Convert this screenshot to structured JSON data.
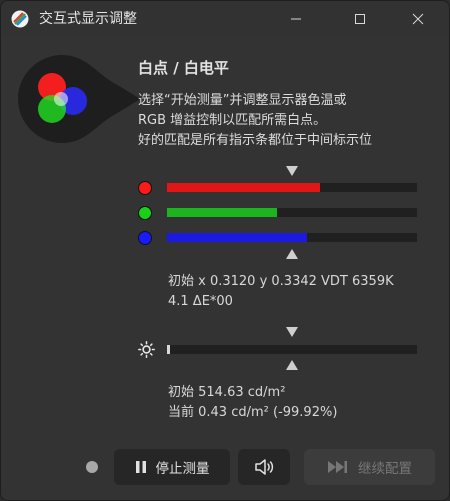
{
  "window": {
    "title": "交互式显示调整",
    "controls": {
      "minimize": "minimize-icon",
      "maximize": "maximize-icon",
      "close": "close-icon"
    }
  },
  "header": {
    "heading": "白点 / 白电平",
    "instructions": [
      "选择“开始测量”并调整显示器色温或",
      "RGB 增益控制以匹配所需白点。",
      "好的匹配是所有指示条都位于中间标示位"
    ]
  },
  "rgb_bars": [
    {
      "name": "red",
      "color": "#ff1a1a",
      "fill_color": "#e21616",
      "level": 0.61
    },
    {
      "name": "green",
      "color": "#1ad11a",
      "fill_color": "#1db51d",
      "level": 0.44
    },
    {
      "name": "blue",
      "color": "#1a1aff",
      "fill_color": "#1a1ae0",
      "level": 0.56
    }
  ],
  "whitepoint_info": {
    "line1": "初始 x 0.3120 y 0.3342 VDT 6359K",
    "line2": "4.1 ΔE*00"
  },
  "luminance": {
    "icon": "brightness-icon",
    "level": 0.01,
    "line1": "初始 514.63 cd/m²",
    "line2": "当前 0.43 cd/m² (-99.92%)"
  },
  "footer": {
    "stop_label": "停止测量",
    "stop_icon": "pause-icon",
    "sound_icon": "speaker-icon",
    "next_label": "继续配置",
    "next_icon": "skip-forward-icon"
  }
}
